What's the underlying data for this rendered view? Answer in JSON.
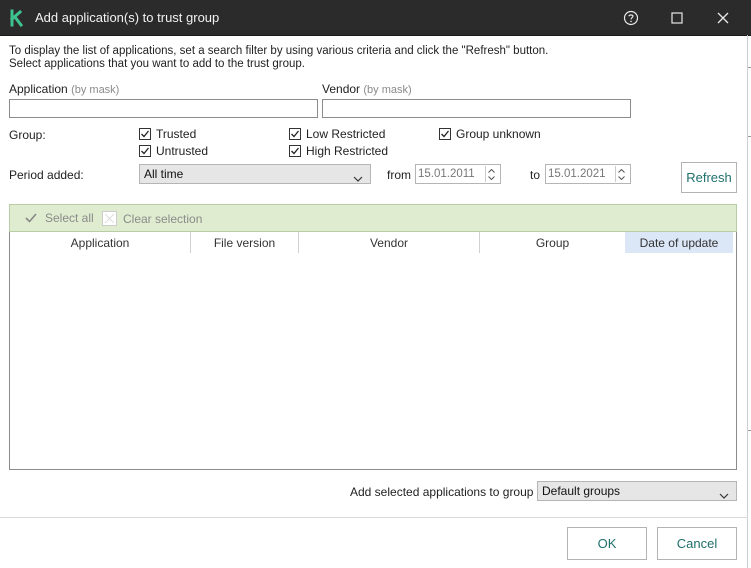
{
  "window": {
    "title": "Add application(s) to trust group",
    "accent": "#1f6f6b"
  },
  "intro": {
    "line1": "To display the list of applications, set a search filter by using various criteria and click the \"Refresh\" button.",
    "line2": "Select applications that you want to add to the trust group."
  },
  "filters": {
    "application_label": "Application",
    "application_hint": "(by mask)",
    "application_value": "",
    "vendor_label": "Vendor",
    "vendor_hint": "(by mask)",
    "vendor_value": "",
    "group_label": "Group:",
    "groups": [
      {
        "label": "Trusted",
        "checked": true
      },
      {
        "label": "Low Restricted",
        "checked": true
      },
      {
        "label": "Group unknown",
        "checked": true
      },
      {
        "label": "Untrusted",
        "checked": true
      },
      {
        "label": "High Restricted",
        "checked": true
      }
    ],
    "period_label": "Period added:",
    "period_value": "All time",
    "from_label": "from",
    "from_value": "15.01.2011",
    "to_label": "to",
    "to_value": "15.01.2021",
    "refresh_label": "Refresh"
  },
  "selection": {
    "select_all": "Select all",
    "clear": "Clear selection"
  },
  "table": {
    "columns": [
      "Application",
      "File version",
      "Vendor",
      "Group",
      "Date of update"
    ],
    "sorted_column": "Date of update",
    "rows": []
  },
  "footer": {
    "add_label": "Add selected applications to group",
    "group_value": "Default groups",
    "ok_label": "OK",
    "cancel_label": "Cancel"
  }
}
